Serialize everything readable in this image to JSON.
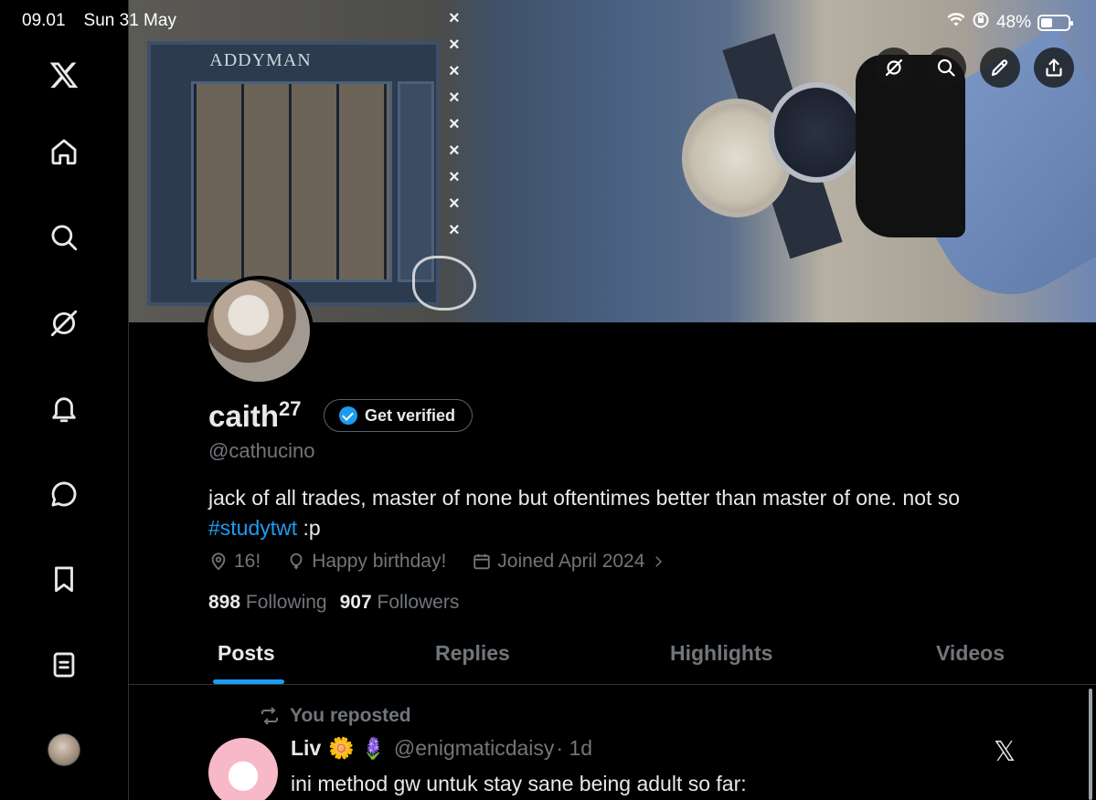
{
  "status": {
    "time": "09.01",
    "date": "Sun 31 May",
    "battery": "48%"
  },
  "sidebar": {
    "items": [
      {
        "icon": "x-logo-icon"
      },
      {
        "icon": "home-icon"
      },
      {
        "icon": "search-icon"
      },
      {
        "icon": "grok-icon"
      },
      {
        "icon": "notifications-icon"
      },
      {
        "icon": "messages-icon"
      },
      {
        "icon": "bookmarks-icon"
      },
      {
        "icon": "lists-icon"
      },
      {
        "icon": "profile-avatar"
      }
    ]
  },
  "banner": {
    "shop_sign": "ADDYMAN"
  },
  "profile": {
    "display_name": "caith",
    "display_name_sup": "27",
    "get_verified": "Get verified",
    "handle": "@cathucino",
    "bio_prefix": "jack of all trades, master of none but oftentimes better than master of one. not so ",
    "bio_hashtag": "#studytwt",
    "bio_suffix": " :p",
    "location": "16!",
    "birthday": "Happy birthday!",
    "joined": "Joined April 2024",
    "following_count": "898",
    "following_label": "Following",
    "followers_count": "907",
    "followers_label": "Followers"
  },
  "tabs": [
    "Posts",
    "Replies",
    "Highlights",
    "Videos"
  ],
  "post": {
    "repost_label": "You reposted",
    "author_name": "Liv",
    "author_emoji": "🌼 🪻",
    "author_handle": "@enigmaticdaisy",
    "age": "· 1d",
    "text": "ini method gw untuk stay sane being adult so far:"
  },
  "colors": {
    "accent": "#1d9bf0",
    "muted": "#71767b",
    "background": "#000000"
  }
}
